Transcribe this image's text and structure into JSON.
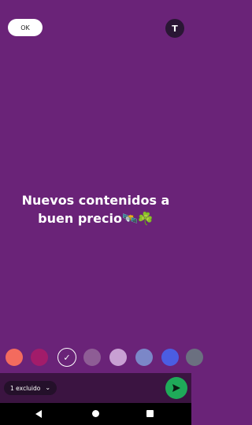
{
  "header": {
    "ok_label": "OK",
    "text_tool_label": "T"
  },
  "story": {
    "line1": "Nuevos contenidos a",
    "line2": "buen precio",
    "emoji": "🛰️☘️"
  },
  "palette": {
    "colors": [
      "#f36b5e",
      "#a21c6a",
      "#6a2378",
      "#8e5d95",
      "#c8a0d3",
      "#7b87c8",
      "#4b5de2",
      "#6b7080"
    ],
    "selected_index": 2,
    "selected_check": "✓"
  },
  "footer": {
    "audience_chip": "1 excluido",
    "chevron": "⌄"
  }
}
